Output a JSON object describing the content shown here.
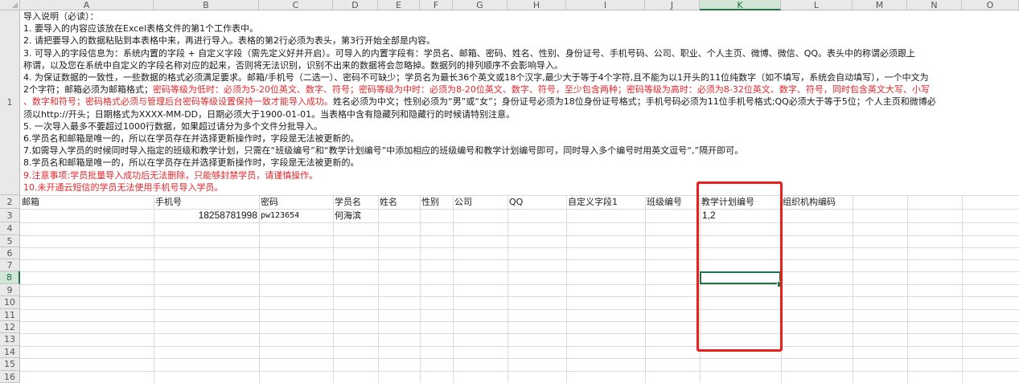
{
  "columns": [
    "A",
    "B",
    "C",
    "D",
    "E",
    "F",
    "G",
    "H",
    "I",
    "J",
    "K",
    "L",
    "M",
    "N",
    "O"
  ],
  "rows": [
    "1",
    "2",
    "3",
    "4",
    "5",
    "6",
    "7",
    "8",
    "9",
    "10",
    "11",
    "12",
    "13",
    "14",
    "15",
    "16"
  ],
  "active_column": "K",
  "active_row": "8",
  "instructions": [
    {
      "text": "导入说明（必读）：",
      "style": "normal"
    },
    {
      "text": "1. 要导入的内容应该放在Excel表格文件的第1个工作表中。",
      "style": "normal"
    },
    {
      "text": "2. 请把要导入的数据粘贴到本表格中来，再进行导入。表格的第2行必须为表头，第3行开始全部是内容。",
      "style": "normal"
    },
    {
      "text": "3. 可导入的字段信息为：系统内置的字段 + 自定义字段（需先定义好并开启）。可导入的内置字段有：学员名、邮箱、密码、姓名、性别、身份证号、手机号码、公司、职业、个人主页、微博、微信、QQ。表头中的称谓必须跟上",
      "style": "normal"
    },
    {
      "text": "称谓，以及您在系统中自定义的字段名称对应的起来，否则将无法识别，识别不出来的数据将会忽略掉。数据列的排列顺序不会影响导入。",
      "style": "normal"
    },
    {
      "text": "4. 为保证数据的一致性，一些数据的格式必须满足要求。邮箱/手机号（二选一）、密码不可缺少；学员名为最长36个英文或18个汉字,最少大于等于4个字符,且不能为以1开头的11位纯数字（如不填写，系统会自动填写），一个中文为",
      "style": "normal"
    },
    {
      "text_parts": [
        {
          "text": "2个字符；邮箱必须为邮箱格式；",
          "style": "normal"
        },
        {
          "text": "密码等级为低时：必须为5-20位英文、数字、符号；密码等级为中时：必须为8-20位英文、数字、符号，至少包含两种；密码等级为高时：必须为8-32位英文、数字、符号，同时包含英文大写、小写",
          "style": "red"
        }
      ]
    },
    {
      "text_parts": [
        {
          "text": "、数字和符号；密码格式必须与管理后台密码等级设置保持一致才能导入成功。",
          "style": "red"
        },
        {
          "text": "姓名必须为中文；性别必须为“男”或“女”；身份证号必须为18位身份证号格式；手机号码必须为11位手机号格式;QQ必须大于等于5位；个人主页和微博必",
          "style": "normal"
        }
      ]
    },
    {
      "text": "须以http://开头；日期格式为XXXX-MM-DD，日期必须大于1900-01-01。当表格中含有隐藏列和隐藏行的时候请特别注意。",
      "style": "normal"
    },
    {
      "text": "5. 一次导入最多不要超过1000行数据，如果超过请分为多个文件分批导入。",
      "style": "normal"
    },
    {
      "text": "6.学员名和邮箱是唯一的，所以在学员存在并选择更新操作时，字段是无法被更新的。",
      "style": "normal"
    },
    {
      "text": "7.如需导入学员的时候同时导入指定的班级和教学计划，只需在“班级编号”和“教学计划编号”中添加相应的班级编号和教学计划编号即可，同时导入多个编号时用英文逗号“,”隔开即可。",
      "style": "normal"
    },
    {
      "text": "8.学员名和邮箱是唯一的，所以在学员存在并选择更新操作时，字段是无法被更新的。",
      "style": "normal"
    },
    {
      "text": "9.注意事项:学员批量导入成功后无法删除，只能够封禁学员，请谨慎操作。",
      "style": "red"
    },
    {
      "text": "10.未开通云短信的学员无法使用手机号导入学员。",
      "style": "red"
    }
  ],
  "header_row": {
    "email": "邮箱",
    "phone": "手机号",
    "password": "密码",
    "student_name": "学员名",
    "name": "姓名",
    "gender": "性别",
    "company": "公司",
    "qq": "QQ",
    "custom_field_1": "自定义字段1",
    "class_id": "班级编号",
    "plan_id": "教学计划编号",
    "org_code": "组织机构编码"
  },
  "data_row": {
    "phone": "18258781998",
    "password": "pw123654",
    "student_name": "何海滨",
    "plan_id": "1,2"
  }
}
